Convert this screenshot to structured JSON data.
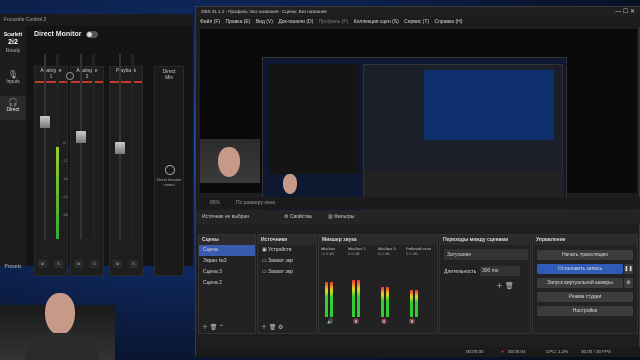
{
  "focusrite": {
    "title": "Focusrite Control 2",
    "device": "Scarlett",
    "device_model": "2i2",
    "device_status": "Ready",
    "nav": [
      "Inputs",
      "Direct"
    ],
    "presets": "Presets",
    "direct_monitor_title": "Direct Monitor",
    "channels": [
      {
        "label": "Analogue\n1",
        "color": "#c0392b"
      },
      {
        "label": "Analogue\n2",
        "color": "#c0392b"
      },
      {
        "label": "Playback",
        "color": "#c0392b"
      }
    ],
    "direct_mix": "Direct\nMix",
    "direct_monitor_muted": "Direct Monitor\nmuted",
    "meter_scale": [
      "-6",
      "-12",
      "-18",
      "-24",
      "-36",
      "-48",
      "-60"
    ],
    "mute_label": "M",
    "solo_label": "S"
  },
  "obs": {
    "title": "OBS 31.1.1 - Профиль: Без названия - Сцены: Без названия",
    "menu": [
      "Файл (F)",
      "Правка (E)",
      "Вид (V)",
      "Док-панели (D)",
      "Профиль (P)",
      "Коллекция сцен (S)",
      "Сервис (T)",
      "Справка (H)"
    ],
    "info_bar": {
      "zoom": "85%",
      "fit": "По размеру окна"
    },
    "source_bar": {
      "no_source": "Источник не выбран",
      "properties": "Свойства",
      "filters": "Фильтры"
    },
    "scenes": {
      "title": "Сцены",
      "items": [
        "Сцена",
        "Экран №2",
        "Сцена 3",
        "Сцена 2"
      ],
      "selected": 0
    },
    "sources": {
      "title": "Источники",
      "items": [
        "Устройств",
        "Захват экр",
        "Захват экр"
      ]
    },
    "mixer": {
      "title": "Микшер звука",
      "channels": [
        "Mic/Aux",
        "Mic/Aux 2",
        "Mic/Aux 3",
        "Рабочий стол"
      ],
      "db": [
        "-1.9 dB",
        "0.0 dB",
        "0.0 dB",
        "0.0 dB"
      ],
      "levels": [
        0.58,
        0.62,
        0.5,
        0.45
      ]
    },
    "transitions": {
      "title": "Переходы между сценами",
      "type": "Затухание",
      "duration_label": "Длительность",
      "duration": "300 ms"
    },
    "controls": {
      "title": "Управление",
      "buttons": [
        "Начать трансляцию",
        "Остановить запись",
        "Запуск виртуальной камеры",
        "Режим студии",
        "Настройки"
      ]
    },
    "status": {
      "rec_time": "00:05:04",
      "stream_time": "00:00:00",
      "cpu": "CPU: 1.2%",
      "fps": "30.00 / 30 FPS"
    }
  },
  "colors": {
    "accent": "#2e5cb8",
    "record": "#c0392b",
    "meter_green": "#3c3"
  }
}
